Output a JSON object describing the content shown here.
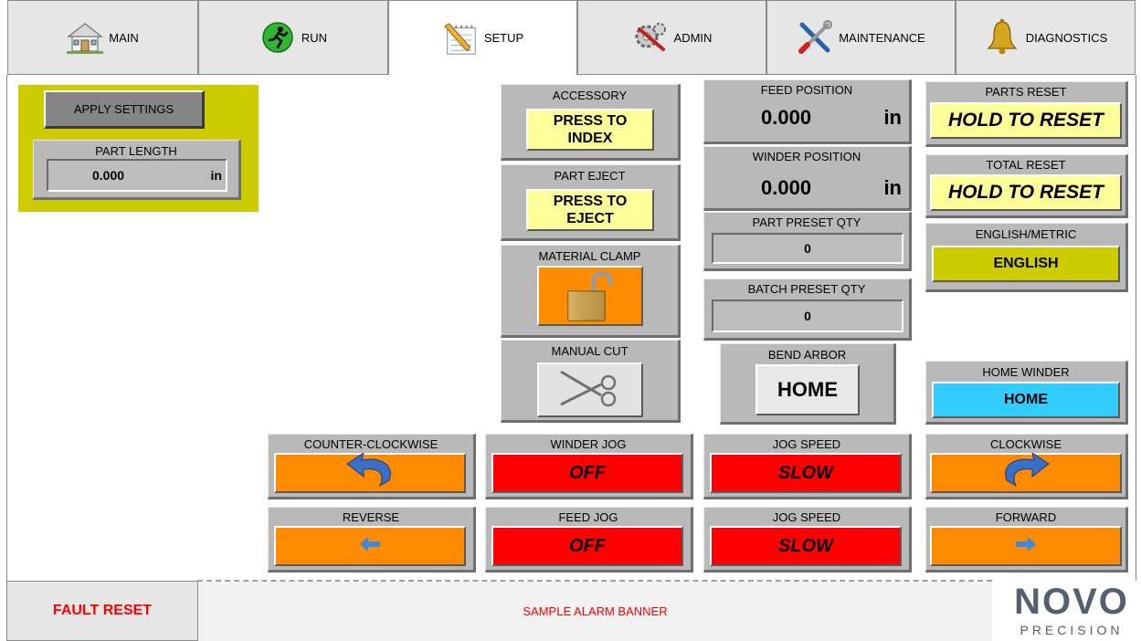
{
  "tabs": [
    {
      "label": "MAIN",
      "icon": "house-icon"
    },
    {
      "label": "RUN",
      "icon": "runner-icon"
    },
    {
      "label": "SETUP",
      "icon": "notepad-icon"
    },
    {
      "label": "ADMIN",
      "icon": "gears-icon"
    },
    {
      "label": "MAINTENANCE",
      "icon": "tools-icon"
    },
    {
      "label": "DIAGNOSTICS",
      "icon": "bell-icon"
    }
  ],
  "setup": {
    "apply_settings": "APPLY SETTINGS",
    "part_length_label": "PART LENGTH",
    "part_length_value": "0.000",
    "part_length_unit": "in"
  },
  "accessory": {
    "label": "ACCESSORY",
    "button": "PRESS TO INDEX"
  },
  "part_eject": {
    "label": "PART EJECT",
    "button": "PRESS TO EJECT"
  },
  "material_clamp": {
    "label": "MATERIAL CLAMP",
    "icon": "padlock-open-icon"
  },
  "manual_cut": {
    "label": "MANUAL CUT",
    "icon": "scissors-icon"
  },
  "feed_position": {
    "label": "FEED POSITION",
    "value": "0.000",
    "unit": "in"
  },
  "winder_position": {
    "label": "WINDER POSITION",
    "value": "0.000",
    "unit": "in"
  },
  "part_preset": {
    "label": "PART PRESET QTY",
    "value": "0"
  },
  "batch_preset": {
    "label": "BATCH PRESET QTY",
    "value": "0"
  },
  "bend_arbor": {
    "label": "BEND ARBOR",
    "button": "HOME"
  },
  "parts_reset": {
    "label": "PARTS RESET",
    "button": "HOLD TO RESET"
  },
  "total_reset": {
    "label": "TOTAL RESET",
    "button": "HOLD TO RESET"
  },
  "units": {
    "label": "ENGLISH/METRIC",
    "button": "ENGLISH"
  },
  "home_winder": {
    "label": "HOME WINDER",
    "button": "HOME"
  },
  "ccw": {
    "label": "COUNTER-CLOCKWISE"
  },
  "winder_jog": {
    "label": "WINDER JOG",
    "button": "OFF"
  },
  "jog_speed_1": {
    "label": "JOG SPEED",
    "button": "SLOW"
  },
  "cw": {
    "label": "CLOCKWISE"
  },
  "reverse": {
    "label": "REVERSE"
  },
  "feed_jog": {
    "label": "FEED JOG",
    "button": "OFF"
  },
  "jog_speed_2": {
    "label": "JOG SPEED",
    "button": "SLOW"
  },
  "forward": {
    "label": "FORWARD"
  },
  "footer": {
    "fault_reset": "FAULT RESET",
    "alarm_banner": "SAMPLE ALARM BANNER",
    "logo_top": "NOVO",
    "logo_bottom": "PRECISION"
  },
  "colors": {
    "yellow_panel": "#cccc00",
    "red": "#ff0000",
    "orange": "#ff8c00",
    "cyan": "#33ccff",
    "pale_yellow": "#ffff99"
  }
}
